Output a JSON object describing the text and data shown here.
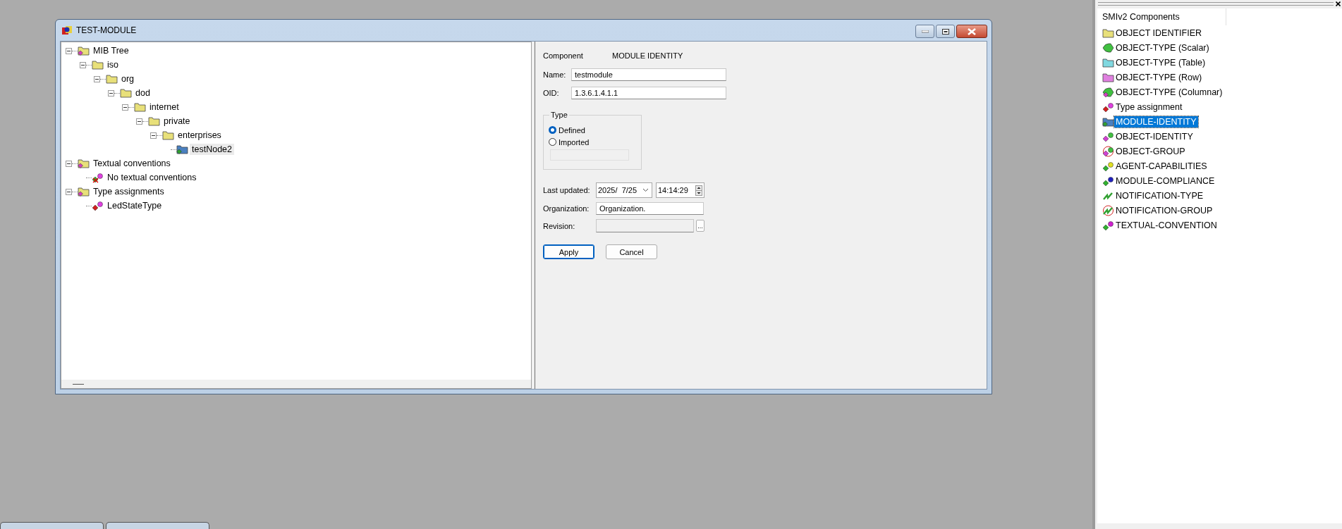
{
  "window": {
    "title": "TEST-MODULE"
  },
  "tree": [
    {
      "label": "MIB Tree",
      "kind": "group",
      "expanded": true,
      "selected": false,
      "children": [
        {
          "label": "iso",
          "kind": "folder",
          "expanded": true,
          "selected": false,
          "children": [
            {
              "label": "org",
              "kind": "folder",
              "expanded": true,
              "selected": false,
              "children": [
                {
                  "label": "dod",
                  "kind": "folder",
                  "expanded": true,
                  "selected": false,
                  "children": [
                    {
                      "label": "internet",
                      "kind": "folder",
                      "expanded": true,
                      "selected": false,
                      "children": [
                        {
                          "label": "private",
                          "kind": "folder",
                          "expanded": true,
                          "selected": false,
                          "children": [
                            {
                              "label": "enterprises",
                              "kind": "folder",
                              "expanded": true,
                              "selected": false,
                              "children": [
                                {
                                  "label": "testNode2",
                                  "kind": "module",
                                  "selected": true
                                }
                              ]
                            }
                          ]
                        }
                      ]
                    }
                  ]
                }
              ]
            }
          ]
        }
      ]
    },
    {
      "label": "Textual conventions",
      "kind": "group",
      "expanded": true,
      "selected": false,
      "children": [
        {
          "label": "No textual conventions",
          "kind": "none",
          "selected": false
        }
      ]
    },
    {
      "label": "Type assignments",
      "kind": "group",
      "expanded": true,
      "selected": false,
      "children": [
        {
          "label": "LedStateType",
          "kind": "type",
          "selected": false
        }
      ]
    }
  ],
  "form": {
    "component_label": "Component",
    "component_value": "MODULE IDENTITY",
    "name": {
      "label": "Name:",
      "value": "testmodule"
    },
    "oid": {
      "label": "OID:",
      "value": "1.3.6.1.4.1.1"
    },
    "type": {
      "title": "Type",
      "options": [
        {
          "label": "Defined",
          "selected": true
        },
        {
          "label": "Imported",
          "selected": false
        }
      ],
      "import_field": {
        "disabled": true
      }
    },
    "last_updated": {
      "label": "Last updated:",
      "date": "2025/  7/25",
      "time": "14:14:29"
    },
    "organization": {
      "label": "Organization:",
      "value": "Organization."
    },
    "revision": {
      "label": "Revision:",
      "disabled": true,
      "browse": "..."
    },
    "buttons": [
      {
        "label": "Apply",
        "kind": "default"
      },
      {
        "label": "Cancel",
        "kind": "normal"
      }
    ]
  },
  "components": {
    "title": "SMIv2 Components",
    "items": [
      {
        "label": "OBJECT IDENTIFIER",
        "kind": "folder",
        "selected": false
      },
      {
        "label": "OBJECT-TYPE (Scalar)",
        "kind": "scalar",
        "selected": false
      },
      {
        "label": "OBJECT-TYPE (Table)",
        "kind": "table",
        "selected": false
      },
      {
        "label": "OBJECT-TYPE (Row)",
        "kind": "row",
        "selected": false
      },
      {
        "label": "OBJECT-TYPE (Columnar)",
        "kind": "columnar",
        "selected": false
      },
      {
        "label": "Type assignment",
        "kind": "type",
        "selected": false
      },
      {
        "label": "MODULE-IDENTITY",
        "kind": "module",
        "selected": true
      },
      {
        "label": "OBJECT-IDENTITY",
        "kind": "identity",
        "selected": false
      },
      {
        "label": "OBJECT-GROUP",
        "kind": "objgroup",
        "selected": false
      },
      {
        "label": "AGENT-CAPABILITIES",
        "kind": "agent",
        "selected": false
      },
      {
        "label": "MODULE-COMPLIANCE",
        "kind": "compliance",
        "selected": false
      },
      {
        "label": "NOTIFICATION-TYPE",
        "kind": "notification",
        "selected": false
      },
      {
        "label": "NOTIFICATION-GROUP",
        "kind": "notifgroup",
        "selected": false
      },
      {
        "label": "TEXTUAL-CONVENTION",
        "kind": "textual",
        "selected": false
      }
    ]
  }
}
